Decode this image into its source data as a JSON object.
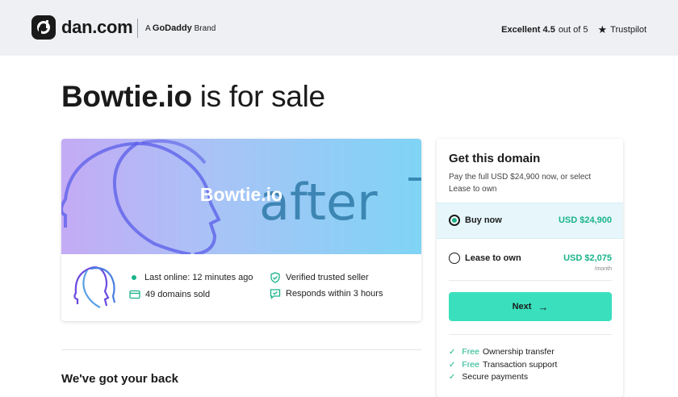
{
  "header": {
    "logo_text": "dan.com",
    "brand_prefix": "A",
    "brand_name": "GoDaddy",
    "brand_suffix": "Brand",
    "rating_label": "Excellent 4.5",
    "rating_suffix": "out of 5",
    "trustpilot": "Trustpilot"
  },
  "title": {
    "domain": "Bowtie.io",
    "suffix": "is for sale"
  },
  "listing": {
    "banner_domain": "Bowtie.io",
    "banner_word": "after",
    "stats": {
      "last_online": "Last online: 12 minutes ago",
      "domains_sold": "49 domains sold",
      "verified": "Verified trusted seller",
      "responds": "Responds within 3 hours"
    }
  },
  "section_title": "We've got your back",
  "purchase": {
    "title": "Get this domain",
    "description": "Pay the full USD $24,900 now, or select Lease to own",
    "options": [
      {
        "label": "Buy now",
        "price": "USD $24,900",
        "sub": "",
        "selected": true
      },
      {
        "label": "Lease to own",
        "price": "USD $2,075",
        "sub": "/month",
        "selected": false
      }
    ],
    "next_label": "Next",
    "features": [
      {
        "free": "Free",
        "text": "Ownership transfer"
      },
      {
        "free": "Free",
        "text": "Transaction support"
      },
      {
        "free": "",
        "text": "Secure payments"
      }
    ]
  },
  "colors": {
    "accent": "#19b38a",
    "button": "#3ae0bd",
    "header_bg": "#eef0f3"
  }
}
